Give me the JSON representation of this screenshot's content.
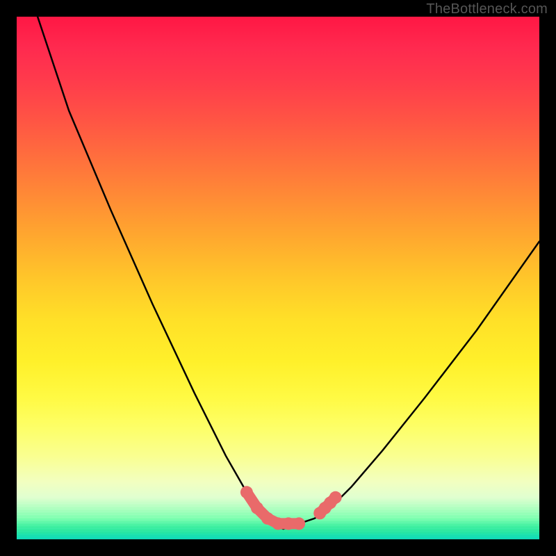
{
  "watermark": "TheBottleneck.com",
  "chart_data": {
    "type": "line",
    "title": "",
    "xlabel": "",
    "ylabel": "",
    "xlim": [
      0,
      100
    ],
    "ylim": [
      0,
      100
    ],
    "grid": false,
    "series": [
      {
        "name": "bottleneck-curve",
        "color": "#000000",
        "x": [
          4,
          10,
          18,
          26,
          34,
          40,
          44,
          47,
          49,
          51,
          54,
          57,
          60,
          64,
          70,
          78,
          88,
          100
        ],
        "y": [
          100,
          82,
          63,
          45,
          28,
          16,
          9,
          5,
          3,
          2,
          3,
          4,
          6,
          10,
          17,
          27,
          40,
          57
        ]
      }
    ],
    "markers": [
      {
        "name": "left-cluster",
        "color": "#e96a6a",
        "points": [
          {
            "x": 44,
            "y": 9
          },
          {
            "x": 46,
            "y": 6
          },
          {
            "x": 48,
            "y": 4
          },
          {
            "x": 50,
            "y": 3
          },
          {
            "x": 52,
            "y": 3
          },
          {
            "x": 54,
            "y": 3
          }
        ]
      },
      {
        "name": "right-cluster",
        "color": "#e96a6a",
        "points": [
          {
            "x": 58,
            "y": 5
          },
          {
            "x": 59,
            "y": 6
          },
          {
            "x": 60,
            "y": 7
          },
          {
            "x": 61,
            "y": 8
          }
        ]
      }
    ]
  }
}
